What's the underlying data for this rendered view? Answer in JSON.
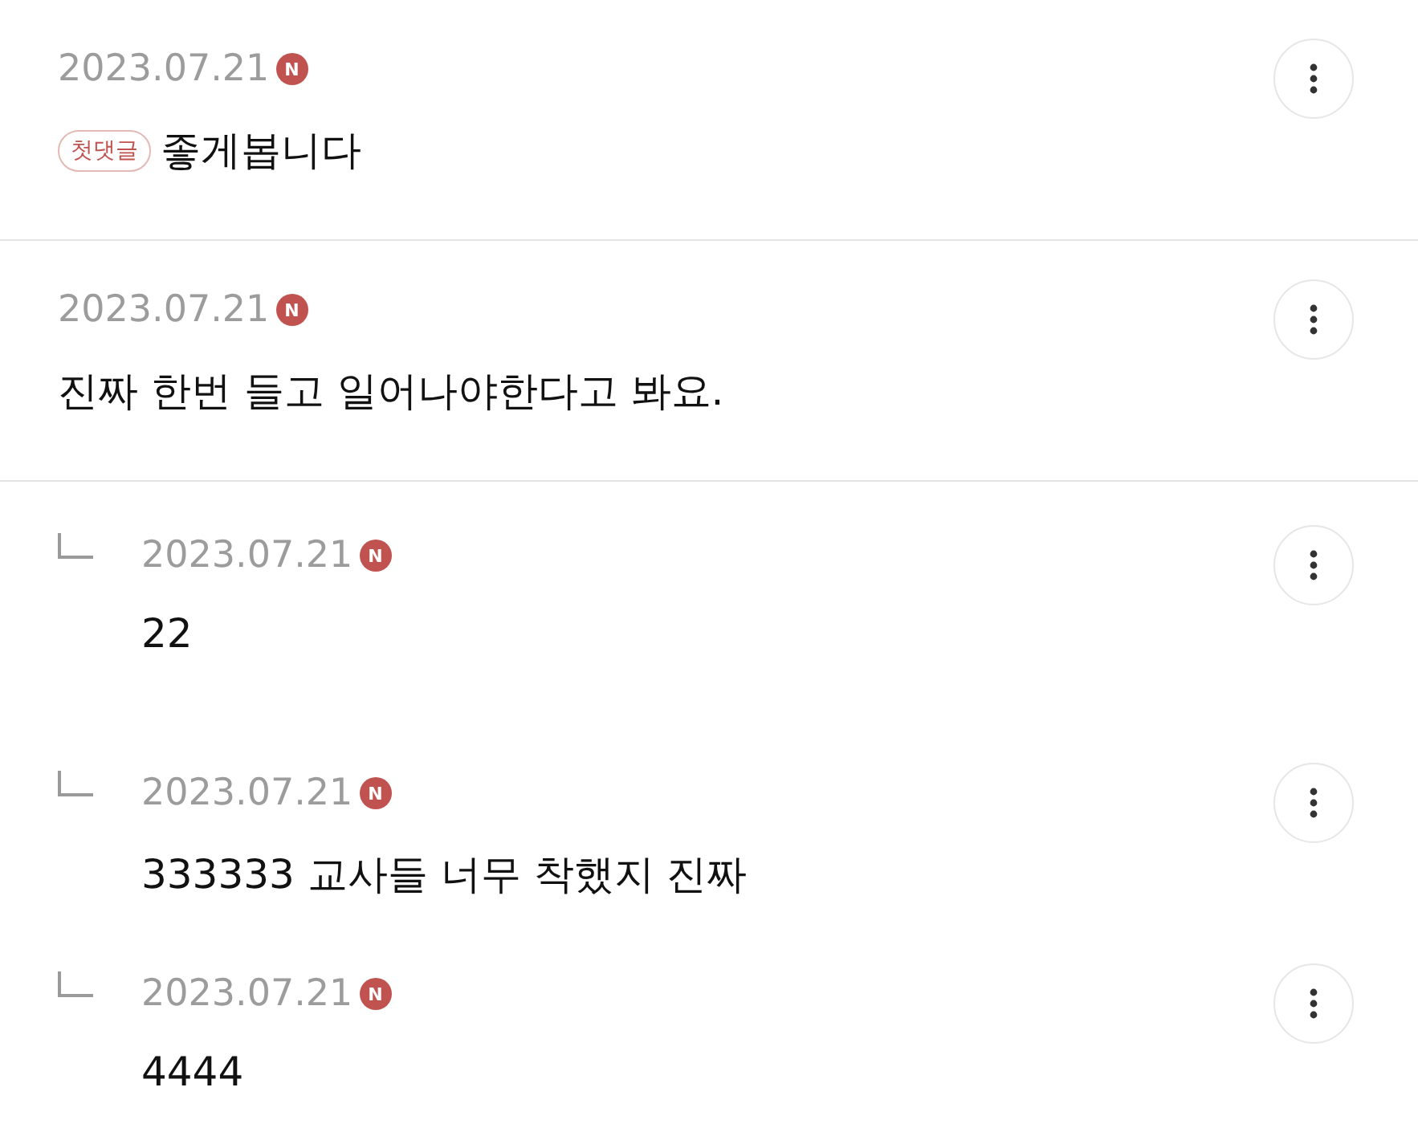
{
  "comments": [
    {
      "kind": "comment",
      "date": "2023.07.21",
      "new_badge": "N",
      "tag": "첫댓글",
      "text": "좋게봅니다"
    },
    {
      "kind": "comment",
      "date": "2023.07.21",
      "new_badge": "N",
      "text": "진짜 한번 들고 일어나야한다고 봐요."
    },
    {
      "kind": "reply",
      "date": "2023.07.21",
      "new_badge": "N",
      "text": "22"
    },
    {
      "kind": "reply",
      "date": "2023.07.21",
      "new_badge": "N",
      "text": "333333 교사들 너무 착했지 진짜"
    },
    {
      "kind": "reply",
      "date": "2023.07.21",
      "new_badge": "N",
      "text": "4444"
    }
  ]
}
